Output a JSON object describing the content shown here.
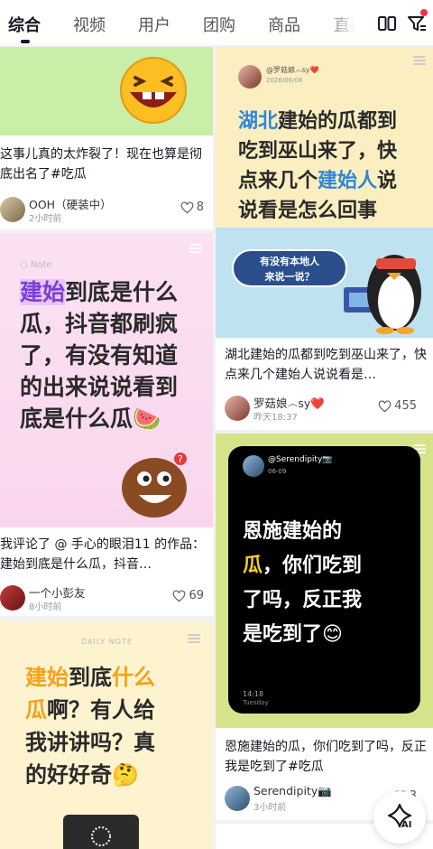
{
  "tabs": [
    {
      "label": "综合",
      "active": true
    },
    {
      "label": "视频",
      "active": false
    },
    {
      "label": "用户",
      "active": false
    },
    {
      "label": "团购",
      "active": false
    },
    {
      "label": "商品",
      "active": false
    },
    {
      "label": "直播",
      "active": false
    }
  ],
  "toolbar": {
    "grid_icon": "dual-column-icon",
    "filter_icon": "filter-icon"
  },
  "cards": {
    "c1": {
      "title": "这事儿真的太炸裂了！现在也算是彻底出名了#吃瓜",
      "author": "OOH（硬装中）",
      "time": "2小时前",
      "likes": "8"
    },
    "c2": {
      "cover_note": "Note",
      "cover_text_hl": "建始",
      "cover_text": "到底是什么瓜，抖音都刷疯了，有没有知道的出来说说看到底是什么瓜🍉",
      "title": "我评论了 @ 手心的眼泪11 的作品：建始到底是什么瓜，抖音…",
      "author": "一个小彭友",
      "time": "8小时前",
      "likes": "69"
    },
    "c3": {
      "cover_label": "DAILY NOTE",
      "cover_hl1": "建始",
      "cover_mid1": "到底",
      "cover_hl2": "什么",
      "cover_hl3": "瓜",
      "cover_rest1": "啊？有人给",
      "cover_rest2": "我讲讲吗？真",
      "cover_rest3": "的好好奇🤔"
    },
    "c4": {
      "cover_user": "@罗菇娘෴sy❤️",
      "cover_date": "2026/06/08",
      "cover_hl1": "湖北",
      "cover_line1": "建始的瓜都到",
      "cover_line2": "吃到巫山来了，快",
      "cover_line3a": "点来几个",
      "cover_hl2": "建始人",
      "cover_line3b": "说",
      "cover_line4": "说看是怎么回事",
      "bubble1": "有没有本地人",
      "bubble2": "来说一说？",
      "title": "湖北建始的瓜都到吃到巫山来了，快点来几个建始人说说看是…",
      "author": "罗菇娘෴sy❤️",
      "time": "昨天18:37",
      "likes": "455"
    },
    "c5": {
      "cover_user": "@Serendipity📷",
      "cover_date": "06-09",
      "cover_line1": "恩施建始的",
      "cover_hl": "瓜",
      "cover_line2": "，你们吃到",
      "cover_line3": "了吗，反正我",
      "cover_line4": "是吃到了😊",
      "cover_clock": "14:18",
      "cover_day": "Tuesday",
      "title": "恩施建始的瓜，你们吃到了吗，反正我是吃到了#吃瓜",
      "author": "Serendipity📷",
      "time": "3小时前",
      "likes": "3"
    }
  },
  "fab": {
    "label": "AI"
  },
  "colors": {
    "accent": "#fe2c55",
    "blue_text": "#2f86d8",
    "orange_text": "#f4a11b"
  }
}
